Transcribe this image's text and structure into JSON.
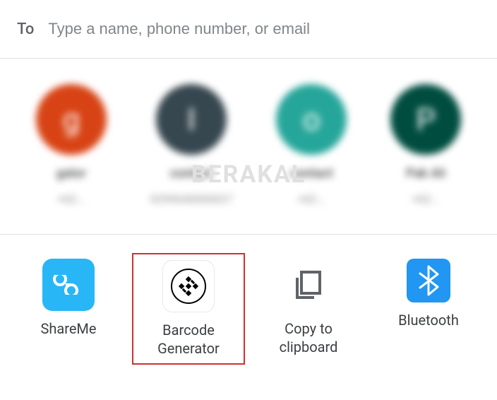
{
  "header": {
    "to_label": "To",
    "placeholder": "Type a name, phone number, or email"
  },
  "contacts": [
    {
      "initial": "g",
      "name": "gator",
      "sub": "+62..."
    },
    {
      "initial": "I",
      "name": "contact",
      "sub": "0299640000027"
    },
    {
      "initial": "o",
      "name": "contact",
      "sub": "+62..."
    },
    {
      "initial": "P",
      "name": "Pak Ali",
      "sub": "+62..."
    }
  ],
  "watermark": "BERAKAL",
  "share_targets": {
    "shareme": "ShareMe",
    "barcode": "Barcode Generator",
    "clipboard": "Copy to clipboard",
    "bluetooth": "Bluetooth"
  }
}
